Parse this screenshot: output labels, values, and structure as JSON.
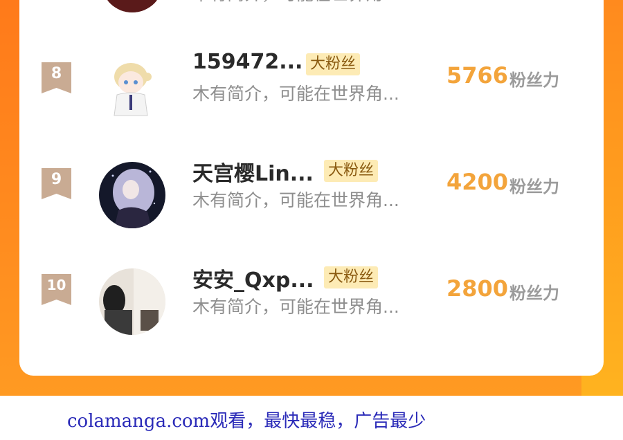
{
  "top_row": {
    "bio": "木有简介，可能在世界角..."
  },
  "fans": [
    {
      "rank": "8",
      "name": "159472...",
      "badge": "大粉丝",
      "bio": "木有简介，可能在世界角...",
      "score": "5766",
      "unit": "粉丝力"
    },
    {
      "rank": "9",
      "name": "天宫樱Lin...",
      "badge": "大粉丝",
      "bio": "木有简介，可能在世界角...",
      "score": "4200",
      "unit": "粉丝力"
    },
    {
      "rank": "10",
      "name": "安安_Qxp...",
      "badge": "大粉丝",
      "bio": "木有简介，可能在世界角...",
      "score": "2800",
      "unit": "粉丝力"
    }
  ],
  "footer": {
    "text": "colamanga.com观看，最快最稳，广告最少"
  },
  "colors": {
    "accent": "#f3a43b",
    "badge_bg": "#fdebb5",
    "rank_ribbon": "#c9ab93",
    "background": "#ff8c1f"
  }
}
